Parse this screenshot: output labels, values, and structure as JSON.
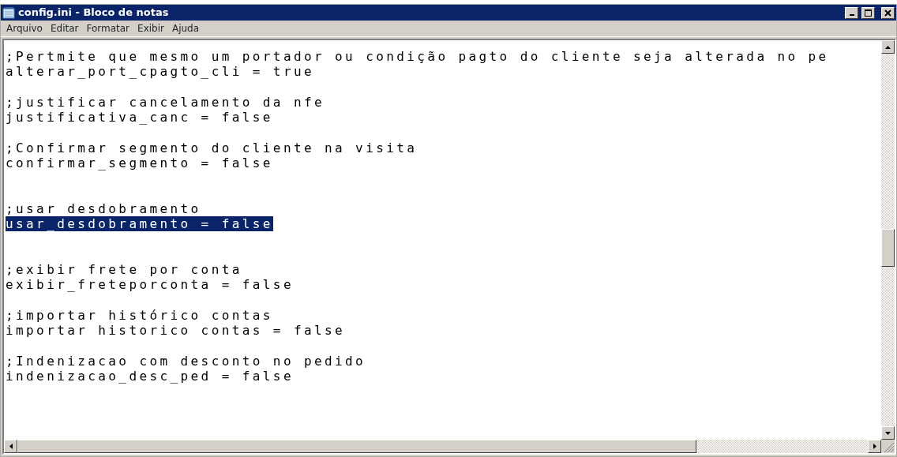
{
  "window": {
    "title": "config.ini - Bloco de notas"
  },
  "menu": [
    {
      "label": "Arquivo"
    },
    {
      "label": "Editar"
    },
    {
      "label": "Formatar"
    },
    {
      "label": "Exibir"
    },
    {
      "label": "Ajuda"
    }
  ],
  "editor": {
    "lines": [
      {
        "kind": "text",
        "text": ";Pertmite que mesmo um portador ou condição pagto do cliente seja alterada no pe",
        "selected": false
      },
      {
        "kind": "text",
        "text": "alterar_port_cpagto_cli = true",
        "selected": false
      },
      {
        "kind": "blank"
      },
      {
        "kind": "text",
        "text": ";justificar cancelamento da nfe",
        "selected": false
      },
      {
        "kind": "text",
        "text": "justificativa_canc = false",
        "selected": false
      },
      {
        "kind": "blank"
      },
      {
        "kind": "text",
        "text": ";Confirmar segmento do cliente na visita",
        "selected": false
      },
      {
        "kind": "text",
        "text": "confirmar_segmento = false",
        "selected": false
      },
      {
        "kind": "blank"
      },
      {
        "kind": "blank"
      },
      {
        "kind": "text",
        "text": ";usar desdobramento",
        "selected": false
      },
      {
        "kind": "text",
        "text": "usar_desdobramento = false",
        "selected": true
      },
      {
        "kind": "blank"
      },
      {
        "kind": "blank"
      },
      {
        "kind": "text",
        "text": ";exibir frete por conta",
        "selected": false
      },
      {
        "kind": "text",
        "text": "exibir_freteporconta = false",
        "selected": false
      },
      {
        "kind": "blank"
      },
      {
        "kind": "text",
        "text": ";importar histórico contas",
        "selected": false
      },
      {
        "kind": "text",
        "text": "importar historico contas = false",
        "selected": false
      },
      {
        "kind": "blank"
      },
      {
        "kind": "text",
        "text": ";Indenizacao com desconto no pedido",
        "selected": false
      },
      {
        "kind": "text",
        "text": "indenizacao_desc_ped = false",
        "selected": false
      }
    ]
  }
}
